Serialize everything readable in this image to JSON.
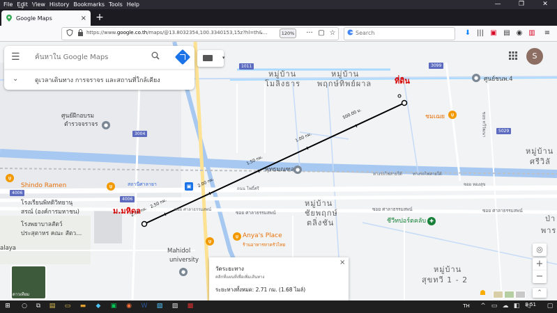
{
  "menubar": {
    "items": [
      "File",
      "Edit",
      "View",
      "History",
      "Bookmarks",
      "Tools",
      "Help"
    ]
  },
  "window_controls": {
    "minimize": "—",
    "restore": "❐",
    "close": "✕"
  },
  "tab": {
    "title": "Google Maps",
    "close": "×",
    "new_tab": "+"
  },
  "nav": {
    "back": "←",
    "forward": "→",
    "reload": "⟳",
    "home": "⌂",
    "url_prefix": "https://www.",
    "url_domain": "google.co.th",
    "url_rest": "/maps/@13.8032354,100.3340153,15z?hl=th&...",
    "zoom": "120%",
    "more": "···",
    "search_placeholder": "Search"
  },
  "maps_panel": {
    "menu_icon": "☰",
    "search_placeholder": "ค้นหาใน Google Maps",
    "search_icon": "🔍",
    "row2_text": "ดูเวลาเดินทาง การจราจร และสถานที่ใกล้เคียง",
    "chevron": "⌄",
    "layer_dropdown": "▾",
    "apps_icon": "⋮⋮",
    "avatar": "S"
  },
  "map_labels": {
    "village_1": "หมู่บ้าน",
    "village_1b": "โมลิงธาร",
    "village_2": "หมู่บ้าน",
    "village_2b": "พฤกษ์ทิพย์ผาล",
    "village_3": "หมู่บ้าน",
    "village_3b": "ศรีวิลั",
    "village_4": "หมู่บ้าน",
    "village_4b": "ชัยพฤกษ์",
    "village_4c": "ตลิ่งชัน",
    "village_5": "หมู่บ้าน",
    "village_5b": "สุขทวี 1 - 2",
    "village_6": "ป่า",
    "village_6b": "พาร",
    "red_target": "ที่ดิน",
    "red_origin": "ม.มหิดล",
    "poi_training": "ศูนย์ฝึกอบรม",
    "poi_training2": "ตำรวจจราจร",
    "poi_4": "ศูนย์ชนพ.4",
    "poi_market": "ชมเฌย",
    "poi_shindo": "Shindo Ramen",
    "poi_station": "สถานีศาลายา",
    "poi_hospital": "โรงพยาบาลสัตว์",
    "poi_hospital2": "ประสุตาหร คณะ สัตว...",
    "poi_school": "โรงเรียนพิทดิวิทยานุ",
    "poi_school2": "สรณ์ (องค์การมหาชน)",
    "poi_anya": "Anya's Place",
    "poi_anya_sub": "ร้านอาหารทาครัวไทย",
    "poi_greenclub": "ชีวีทปอร์ตคลับ",
    "poi_mahidol": "Mahidol",
    "poi_mahidol2": "university",
    "poi_phuttha": "พุทธมณฑล",
    "poi_laya": "alaya",
    "road_1": "ซอย ศาลาธรรมสพน์",
    "road_2": "ซอย ศาลาธรรมสพน์",
    "road_3": "ซอย ศาลาธรรมสพน์",
    "road_rail": "ทางรถไฟสายใต้",
    "road_rail2": "ทางรถไฟสายใต้",
    "road_bypass": "ถนน โพธิ์ศรี",
    "road_v": "ซอย ทวีวัฒนา",
    "road_sh1": "3004",
    "road_sh2": "1011",
    "road_sh3": "3099",
    "road_sh4": "5029",
    "road_sh5": "4006",
    "road_sh6": "4006",
    "road_label_small1": "ซอย ทองสุข",
    "road_label_small2": "ซอย ศาลาธรรมสพน์"
  },
  "distance_markers": [
    "2.71 กม.",
    "2.50 กม.",
    "2.00 กม.",
    "1.50 กม.",
    "1.00 กม.",
    "500.00 ม."
  ],
  "measure_card": {
    "title": "วัดระยะทาง",
    "subtitle": "คลิกที่แผนที่เพื่อเพิ่มเส้นทาง",
    "total": "ระยะทางทั้งหมด: 2.71 กม. (1.68 ไมล์)",
    "close": "×"
  },
  "map_controls": {
    "locate": "◎",
    "zoom_in": "+",
    "zoom_out": "−",
    "expand": "⌃",
    "satellite_label": "ดาวเทียม"
  },
  "taskbar": {
    "time": "8:51",
    "lang": "TH",
    "notif": "▢"
  },
  "colors": {
    "tab_bg": "#1c1b22",
    "water": "#aadaff",
    "road_blue": "#a7c8f0",
    "measure_line": "#000000",
    "avatar": "#8d6e63"
  }
}
